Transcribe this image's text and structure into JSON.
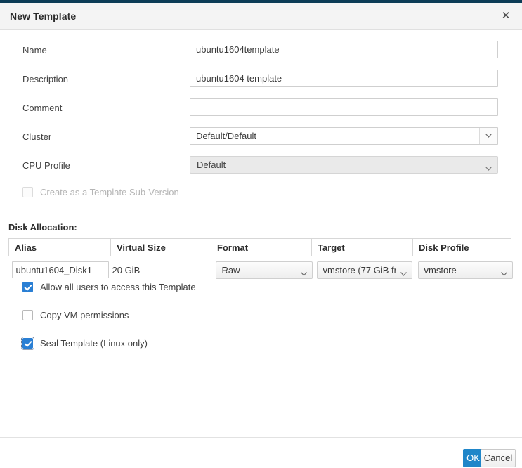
{
  "dialog": {
    "title": "New Template",
    "close_icon": "close-icon"
  },
  "form": {
    "name": {
      "label": "Name",
      "value": "ubuntu1604template",
      "placeholder": ""
    },
    "description": {
      "label": "Description",
      "value": "ubuntu1604 template",
      "placeholder": ""
    },
    "comment": {
      "label": "Comment",
      "value": "",
      "placeholder": ""
    },
    "cluster": {
      "label": "Cluster",
      "value": "Default/Default"
    },
    "cpu_profile": {
      "label": "CPU Profile",
      "value": "Default"
    },
    "template_subversion": {
      "label": "Create as a Template Sub-Version",
      "checked": false,
      "disabled": true
    }
  },
  "disk_allocation": {
    "section_title": "Disk Allocation:",
    "columns": [
      "Alias",
      "Virtual Size",
      "Format",
      "Target",
      "Disk Profile"
    ],
    "rows": [
      {
        "alias": "ubuntu1604_Disk1",
        "virtual_size": "20 GiB",
        "format": "Raw",
        "target": "vmstore (77 GiB fr",
        "disk_profile": "vmstore"
      }
    ]
  },
  "options": {
    "allow_all_users": {
      "label": "Allow all users to access this Template",
      "checked": true
    },
    "copy_vm_permissions": {
      "label": "Copy VM permissions",
      "checked": false
    },
    "seal_template": {
      "label": "Seal Template (Linux only)",
      "checked": true
    }
  },
  "footer": {
    "ok_label": "OK",
    "cancel_label": "Cancel"
  },
  "colors": {
    "top_strip": "#0c3c56",
    "accent_blue": "#1f86c9",
    "checkbox_blue": "#2a7fd4"
  }
}
